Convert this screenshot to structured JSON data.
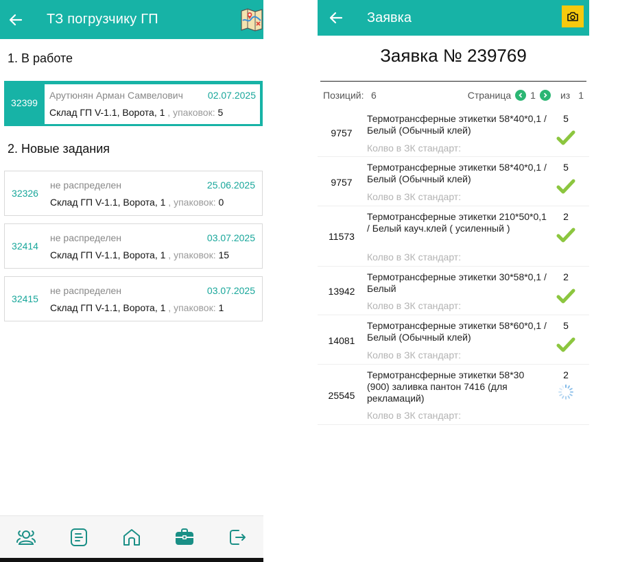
{
  "left": {
    "header": {
      "title": "ТЗ погрузчику ГП"
    },
    "sections": {
      "in_work": "1. В работе",
      "new_tasks": "2. Новые задания"
    },
    "active_task": {
      "id": "32399",
      "assignee": "Арутюнян Арман Самвелович",
      "date": "02.07.2025",
      "location": "Склад ГП V-1.1, Ворота, 1",
      "pack_label": ", упаковок:",
      "packs": "5"
    },
    "new_tasks": [
      {
        "id": "32326",
        "assignee": "не распределен",
        "date": "25.06.2025",
        "location": "Склад ГП V-1.1, Ворота, 1",
        "pack_label": ", упаковок:",
        "packs": "0"
      },
      {
        "id": "32414",
        "assignee": "не распределен",
        "date": "03.07.2025",
        "location": "Склад ГП V-1.1, Ворота, 1",
        "pack_label": ", упаковок:",
        "packs": "15"
      },
      {
        "id": "32415",
        "assignee": "не распределен",
        "date": "03.07.2025",
        "location": "Склад ГП V-1.1, Ворота, 1",
        "pack_label": ", упаковок:",
        "packs": "1"
      }
    ],
    "bottom_nav": [
      "users-icon",
      "document-icon",
      "home-icon",
      "briefcase-icon",
      "logout-icon"
    ]
  },
  "right": {
    "header": {
      "title": "Заявка"
    },
    "order_title": "Заявка № 239769",
    "positions_label": "Позиций:",
    "positions_count": "6",
    "page_label": "Страница",
    "page_current": "1",
    "page_of": "из",
    "page_total": "1",
    "std_label": "Колво в ЗК стандарт:",
    "items": [
      {
        "code": "9757",
        "name": "Термотрансферные этикетки 58*40*0,1 / Белый (Обычный клей)",
        "qty": "5",
        "status": "check"
      },
      {
        "code": "9757",
        "name": "Термотрансферные этикетки 58*40*0,1 / Белый (Обычный клей)",
        "qty": "5",
        "status": "check"
      },
      {
        "code": "11573",
        "name": "Термотрансферные этикетки 210*50*0,1 / Белый кауч.клей ( усиленный )",
        "qty": "2",
        "status": "check"
      },
      {
        "code": "13942",
        "name": "Термотрансферные этикетки 30*58*0,1 / Белый",
        "qty": "2",
        "status": "check"
      },
      {
        "code": "14081",
        "name": "Термотрансферные этикетки 58*60*0,1 / Белый (Обычный клей)",
        "qty": "5",
        "status": "check"
      },
      {
        "code": "25545",
        "name": "Термотрансферные этикетки 58*30 (900) заливка пантон 7416 (для рекламаций)",
        "qty": "2",
        "status": "loading"
      }
    ]
  },
  "colors": {
    "primary": "#17b3a6",
    "accent": "#f6c90e",
    "check": "#8cc63f",
    "pager": "#2bb673"
  }
}
